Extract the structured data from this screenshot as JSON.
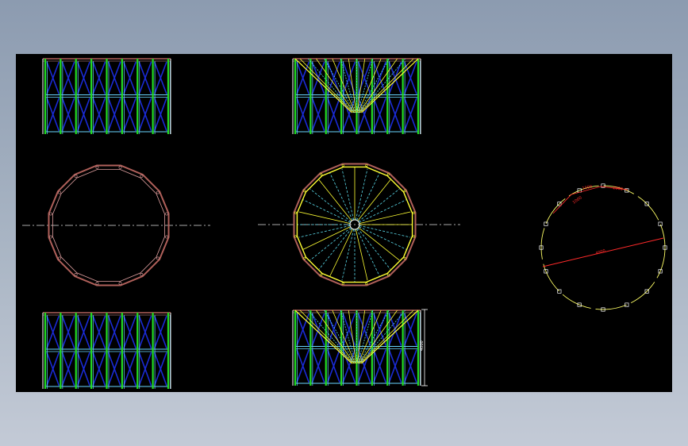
{
  "viewer": {
    "background_color": "#000000",
    "frame_gradient": [
      "#8c9bb0",
      "#c3cad6"
    ]
  },
  "drawing": {
    "colors": {
      "column": "#22dd22",
      "brace": "#1a2bd6",
      "beam": "#6ad6ff",
      "ring": "#b0605a",
      "ring_inner": "#e0a0a0",
      "cone": "#ffff33",
      "cone_dashed": "#5ad8e8",
      "centerline": "#e0e0e0",
      "dimension": "#ff2a2a",
      "anchor_circle": "#ffff66",
      "post": "#ffffff"
    },
    "ring_sides": 16,
    "cone_ribs": 28,
    "anchor_bolt_count": 16,
    "dimension_labels": {
      "arc_1": "1000",
      "arc_2": "1000",
      "arc_3": "1000",
      "diameter": "4000",
      "height": "4000"
    }
  }
}
